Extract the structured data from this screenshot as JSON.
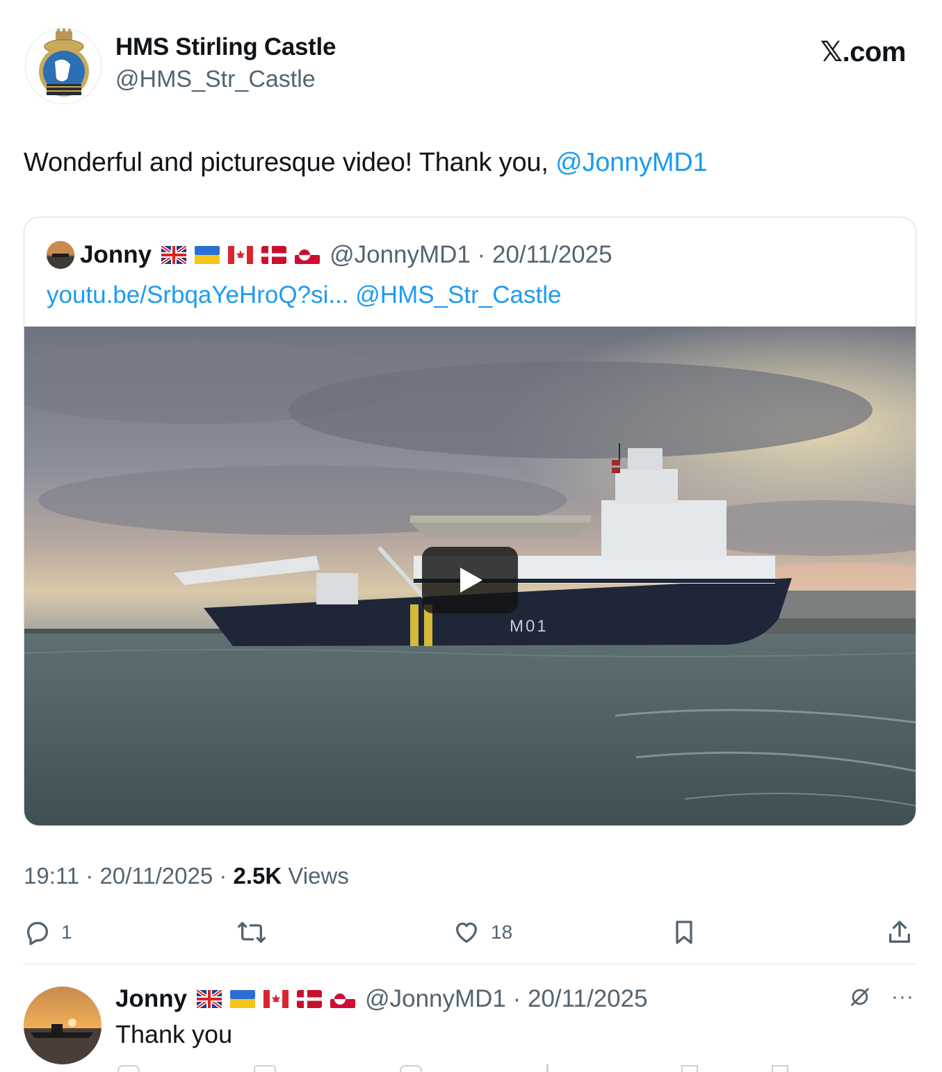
{
  "author": {
    "name": "HMS Stirling Castle",
    "handle": "@HMS_Str_Castle"
  },
  "brand": "𝕏.com",
  "tweet": {
    "text_before": "Wonderful and picturesque video! Thank you, ",
    "mention": "@JonnyMD1"
  },
  "quote": {
    "name": "Jonny",
    "handle_date": "@JonnyMD1 · 20/11/2025",
    "link": "youtu.be/SrbqaYeHroQ?si...",
    "mention": "@HMS_Str_Castle",
    "media_label": "M01"
  },
  "meta": {
    "time_date": "19:11 · 20/11/2025 · ",
    "views_count": "2.5K",
    "views_label": " Views"
  },
  "actions": {
    "replies": "1",
    "likes": "18"
  },
  "reply": {
    "name": "Jonny",
    "handle_date": "@JonnyMD1 · 20/11/2025",
    "text": "Thank you",
    "more": "···"
  },
  "colors": {
    "link": "#1d9bf0",
    "secondary_text": "#536471",
    "divider": "#e5eaec",
    "border": "#cfd9de"
  },
  "icons": [
    "reply-icon",
    "retweet-icon",
    "like-icon",
    "bookmark-icon",
    "share-icon",
    "grok-icon",
    "more-icon",
    "play-icon"
  ]
}
